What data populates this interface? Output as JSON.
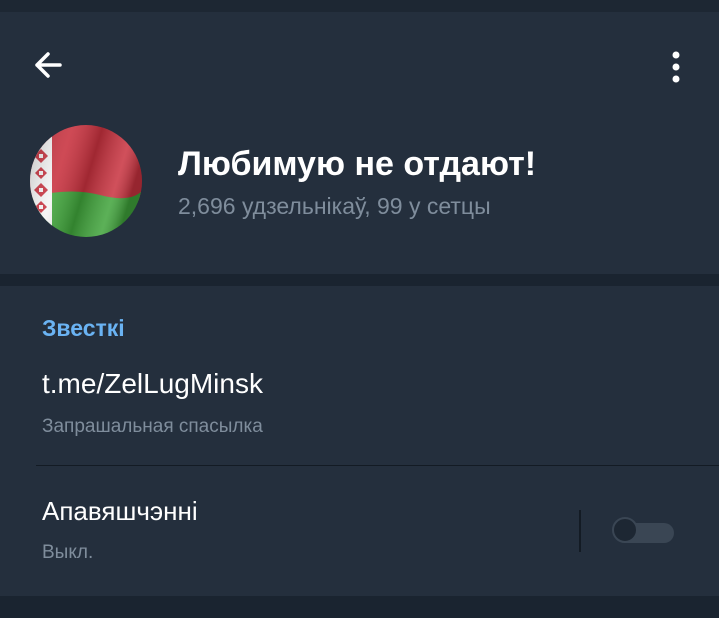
{
  "header": {
    "title": "Любимую не отдают!",
    "subtitle": "2,696 удзельнікаў, 99 у сетцы",
    "back_icon": "arrow-left-icon",
    "menu_icon": "more-vertical-icon",
    "avatar": "belarus-flag"
  },
  "info": {
    "section_title": "Звесткі",
    "link": {
      "value": "t.me/ZelLugMinsk",
      "caption": "Запрашальная спасылка"
    },
    "notifications": {
      "label": "Апавяшчэнні",
      "status": "Выкл.",
      "enabled": false
    }
  },
  "colors": {
    "background": "#1d2733",
    "header": "#242f3d",
    "accent": "#6ab3f3",
    "secondary_text": "#7f8d9c"
  }
}
